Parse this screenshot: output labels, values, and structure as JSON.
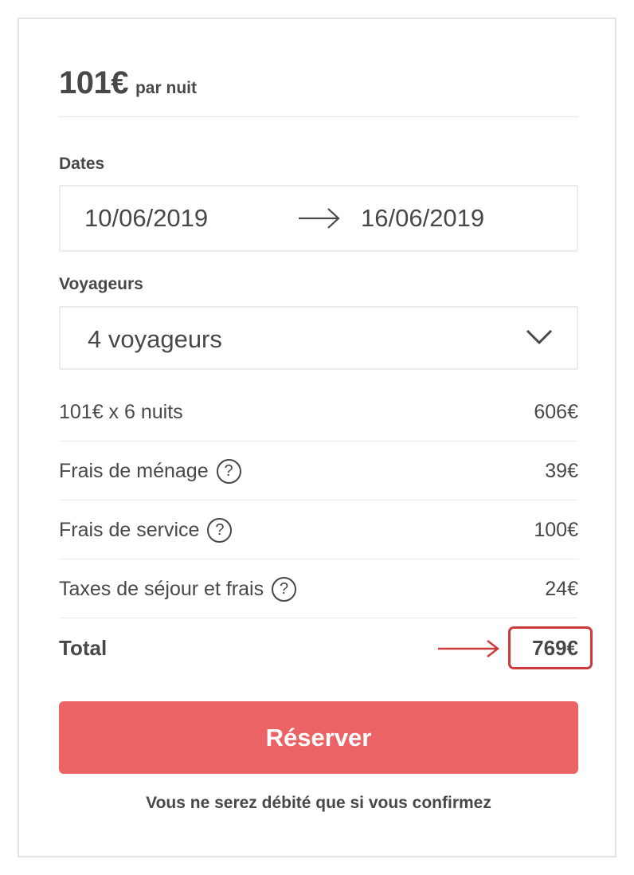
{
  "listing": {
    "price": "101€",
    "per_night": "par nuit"
  },
  "dates": {
    "label": "Dates",
    "check_in": "10/06/2019",
    "check_out": "16/06/2019"
  },
  "guests": {
    "label": "Voyageurs",
    "selected": "4 voyageurs"
  },
  "breakdown": [
    {
      "label": "101€ x 6 nuits",
      "value": "606€",
      "help": false
    },
    {
      "label": "Frais de ménage",
      "value": "39€",
      "help": true
    },
    {
      "label": "Frais de service",
      "value": "100€",
      "help": true
    },
    {
      "label": "Taxes de séjour et frais",
      "value": "24€",
      "help": true
    }
  ],
  "total": {
    "label": "Total",
    "value": "769€"
  },
  "help_glyph": "?",
  "reserve_label": "Réserver",
  "footnote": "Vous ne serez débité que si vous confirmez",
  "colors": {
    "accent": "#ec6366",
    "highlight": "#cc3b3b",
    "text": "#484848"
  }
}
